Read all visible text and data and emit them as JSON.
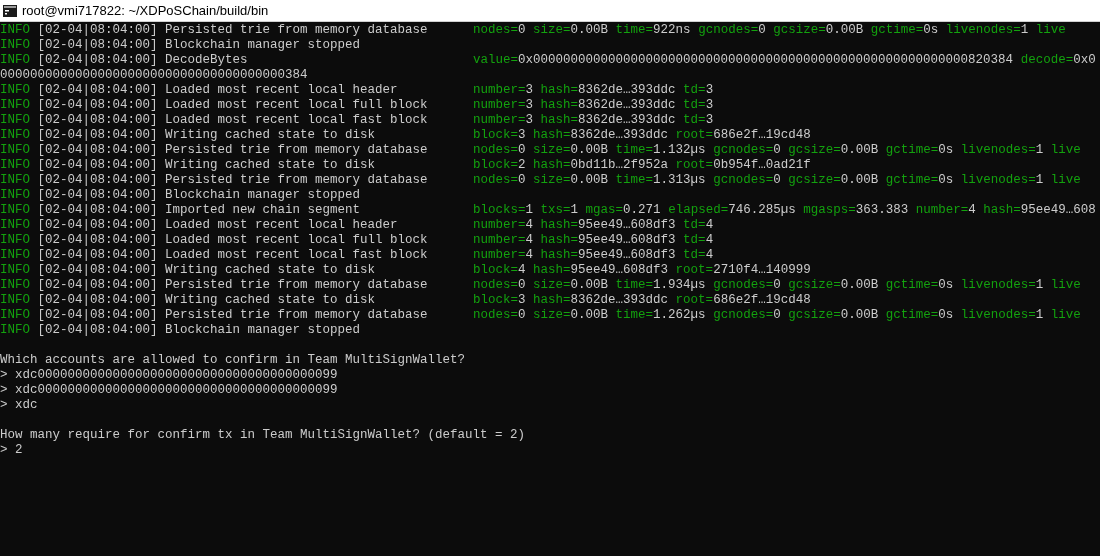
{
  "window": {
    "title": "root@vmi717822: ~/XDPoSChain/build/bin"
  },
  "lines": [
    {
      "kind": "log",
      "level": "INFO",
      "time": "[02-04|08:04:00]",
      "message": "Persisted trie from memory database",
      "fields": [
        {
          "key": "nodes=",
          "value": "0"
        },
        {
          "key": "size=",
          "value": "0.00B"
        },
        {
          "key": "time=",
          "value": "922ns"
        },
        {
          "key": "gcnodes=",
          "value": "0"
        },
        {
          "key": "gcsize=",
          "value": "0.00B"
        },
        {
          "key": "gctime=",
          "value": "0s"
        },
        {
          "key": "livenodes=",
          "value": "1"
        },
        {
          "key": "live"
        }
      ]
    },
    {
      "kind": "log",
      "level": "INFO",
      "time": "[02-04|08:04:00]",
      "message": "Blockchain manager stopped"
    },
    {
      "kind": "log",
      "level": "INFO",
      "time": "[02-04|08:04:00]",
      "message": "DecodeBytes",
      "fields": [
        {
          "key": "value=",
          "value": "0x0000000000000000000000000000000000000000000000000000000000820384"
        },
        {
          "key": "decode=",
          "value": "0x0"
        }
      ]
    },
    {
      "kind": "text",
      "text": "00000000000000000000000000000000000000384"
    },
    {
      "kind": "log",
      "level": "INFO",
      "time": "[02-04|08:04:00]",
      "message": "Loaded most recent local header",
      "fields": [
        {
          "key": "number=",
          "value": "3"
        },
        {
          "key": "hash=",
          "value": "8362de…393ddc"
        },
        {
          "key": "td=",
          "value": "3"
        }
      ]
    },
    {
      "kind": "log",
      "level": "INFO",
      "time": "[02-04|08:04:00]",
      "message": "Loaded most recent local full block",
      "fields": [
        {
          "key": "number=",
          "value": "3"
        },
        {
          "key": "hash=",
          "value": "8362de…393ddc"
        },
        {
          "key": "td=",
          "value": "3"
        }
      ]
    },
    {
      "kind": "log",
      "level": "INFO",
      "time": "[02-04|08:04:00]",
      "message": "Loaded most recent local fast block",
      "fields": [
        {
          "key": "number=",
          "value": "3"
        },
        {
          "key": "hash=",
          "value": "8362de…393ddc"
        },
        {
          "key": "td=",
          "value": "3"
        }
      ]
    },
    {
      "kind": "log",
      "level": "INFO",
      "time": "[02-04|08:04:00]",
      "message": "Writing cached state to disk",
      "fields": [
        {
          "key": "block=",
          "value": "3"
        },
        {
          "key": "hash=",
          "value": "8362de…393ddc"
        },
        {
          "key": "root=",
          "value": "686e2f…19cd48"
        }
      ]
    },
    {
      "kind": "log",
      "level": "INFO",
      "time": "[02-04|08:04:00]",
      "message": "Persisted trie from memory database",
      "fields": [
        {
          "key": "nodes=",
          "value": "0"
        },
        {
          "key": "size=",
          "value": "0.00B"
        },
        {
          "key": "time=",
          "value": "1.132µs"
        },
        {
          "key": "gcnodes=",
          "value": "0"
        },
        {
          "key": "gcsize=",
          "value": "0.00B"
        },
        {
          "key": "gctime=",
          "value": "0s"
        },
        {
          "key": "livenodes=",
          "value": "1"
        },
        {
          "key": "live"
        }
      ]
    },
    {
      "kind": "log",
      "level": "INFO",
      "time": "[02-04|08:04:00]",
      "message": "Writing cached state to disk",
      "fields": [
        {
          "key": "block=",
          "value": "2"
        },
        {
          "key": "hash=",
          "value": "0bd11b…2f952a"
        },
        {
          "key": "root=",
          "value": "0b954f…0ad21f"
        }
      ]
    },
    {
      "kind": "log",
      "level": "INFO",
      "time": "[02-04|08:04:00]",
      "message": "Persisted trie from memory database",
      "fields": [
        {
          "key": "nodes=",
          "value": "0"
        },
        {
          "key": "size=",
          "value": "0.00B"
        },
        {
          "key": "time=",
          "value": "1.313µs"
        },
        {
          "key": "gcnodes=",
          "value": "0"
        },
        {
          "key": "gcsize=",
          "value": "0.00B"
        },
        {
          "key": "gctime=",
          "value": "0s"
        },
        {
          "key": "livenodes=",
          "value": "1"
        },
        {
          "key": "live"
        }
      ]
    },
    {
      "kind": "log",
      "level": "INFO",
      "time": "[02-04|08:04:00]",
      "message": "Blockchain manager stopped"
    },
    {
      "kind": "log",
      "level": "INFO",
      "time": "[02-04|08:04:00]",
      "message": "Imported new chain segment",
      "fields": [
        {
          "key": "blocks=",
          "value": "1"
        },
        {
          "key": "txs=",
          "value": "1"
        },
        {
          "key": "mgas=",
          "value": "0.271"
        },
        {
          "key": "elapsed=",
          "value": "746.285µs"
        },
        {
          "key": "mgasps=",
          "value": "363.383"
        },
        {
          "key": "number=",
          "value": "4"
        },
        {
          "key": "hash=",
          "value": "95ee49…608"
        }
      ]
    },
    {
      "kind": "log",
      "level": "INFO",
      "time": "[02-04|08:04:00]",
      "message": "Loaded most recent local header",
      "fields": [
        {
          "key": "number=",
          "value": "4"
        },
        {
          "key": "hash=",
          "value": "95ee49…608df3"
        },
        {
          "key": "td=",
          "value": "4"
        }
      ]
    },
    {
      "kind": "log",
      "level": "INFO",
      "time": "[02-04|08:04:00]",
      "message": "Loaded most recent local full block",
      "fields": [
        {
          "key": "number=",
          "value": "4"
        },
        {
          "key": "hash=",
          "value": "95ee49…608df3"
        },
        {
          "key": "td=",
          "value": "4"
        }
      ]
    },
    {
      "kind": "log",
      "level": "INFO",
      "time": "[02-04|08:04:00]",
      "message": "Loaded most recent local fast block",
      "fields": [
        {
          "key": "number=",
          "value": "4"
        },
        {
          "key": "hash=",
          "value": "95ee49…608df3"
        },
        {
          "key": "td=",
          "value": "4"
        }
      ]
    },
    {
      "kind": "log",
      "level": "INFO",
      "time": "[02-04|08:04:00]",
      "message": "Writing cached state to disk",
      "fields": [
        {
          "key": "block=",
          "value": "4"
        },
        {
          "key": "hash=",
          "value": "95ee49…608df3"
        },
        {
          "key": "root=",
          "value": "2710f4…140999"
        }
      ]
    },
    {
      "kind": "log",
      "level": "INFO",
      "time": "[02-04|08:04:00]",
      "message": "Persisted trie from memory database",
      "fields": [
        {
          "key": "nodes=",
          "value": "0"
        },
        {
          "key": "size=",
          "value": "0.00B"
        },
        {
          "key": "time=",
          "value": "1.934µs"
        },
        {
          "key": "gcnodes=",
          "value": "0"
        },
        {
          "key": "gcsize=",
          "value": "0.00B"
        },
        {
          "key": "gctime=",
          "value": "0s"
        },
        {
          "key": "livenodes=",
          "value": "1"
        },
        {
          "key": "live"
        }
      ]
    },
    {
      "kind": "log",
      "level": "INFO",
      "time": "[02-04|08:04:00]",
      "message": "Writing cached state to disk",
      "fields": [
        {
          "key": "block=",
          "value": "3"
        },
        {
          "key": "hash=",
          "value": "8362de…393ddc"
        },
        {
          "key": "root=",
          "value": "686e2f…19cd48"
        }
      ]
    },
    {
      "kind": "log",
      "level": "INFO",
      "time": "[02-04|08:04:00]",
      "message": "Persisted trie from memory database",
      "fields": [
        {
          "key": "nodes=",
          "value": "0"
        },
        {
          "key": "size=",
          "value": "0.00B"
        },
        {
          "key": "time=",
          "value": "1.262µs"
        },
        {
          "key": "gcnodes=",
          "value": "0"
        },
        {
          "key": "gcsize=",
          "value": "0.00B"
        },
        {
          "key": "gctime=",
          "value": "0s"
        },
        {
          "key": "livenodes=",
          "value": "1"
        },
        {
          "key": "live"
        }
      ]
    },
    {
      "kind": "log",
      "level": "INFO",
      "time": "[02-04|08:04:00]",
      "message": "Blockchain manager stopped"
    },
    {
      "kind": "blank"
    },
    {
      "kind": "text",
      "text": "Which accounts are allowed to confirm in Team MultiSignWallet?"
    },
    {
      "kind": "text",
      "text": "> xdc0000000000000000000000000000000000000099"
    },
    {
      "kind": "text",
      "text": "> xdc0000000000000000000000000000000000000099"
    },
    {
      "kind": "text",
      "text": "> xdc"
    },
    {
      "kind": "blank"
    },
    {
      "kind": "text",
      "text": "How many require for confirm tx in Team MultiSignWallet? (default = 2)"
    },
    {
      "kind": "text",
      "text": "> 2"
    }
  ]
}
